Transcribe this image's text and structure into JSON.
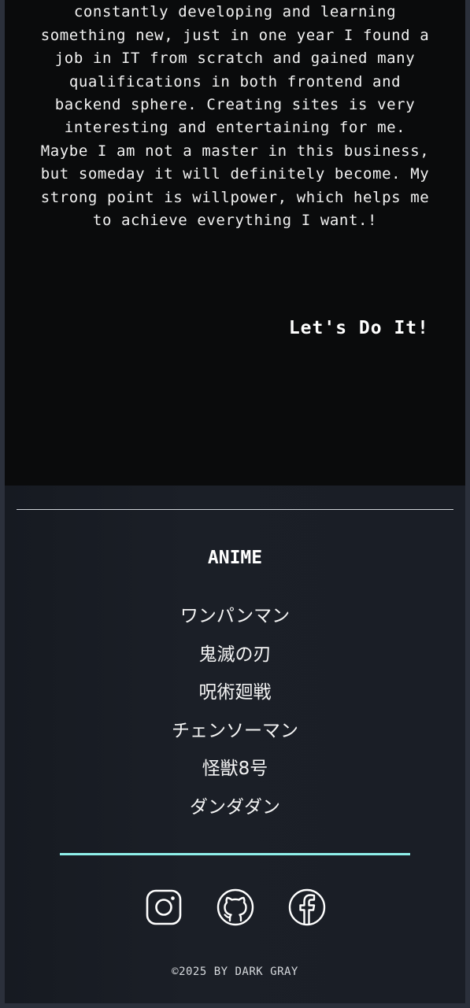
{
  "about": {
    "paragraph": "of the examples of my designer work. I am constantly developing and learning something new, just in one year I found a job in IT from scratch and gained many qualifications in both frontend and backend sphere. Creating sites is very interesting and entertaining for me. Maybe I am not a master in this business, but someday it will definitely become. My strong point is willpower, which helps me to achieve everything I want.!",
    "cta_label": "Let's Do It!"
  },
  "footer": {
    "title": "ANIME",
    "anime": [
      "ワンパンマン",
      "鬼滅の刃",
      "呪術廻戦",
      "チェンソーマン",
      "怪獣8号",
      "ダンダダン"
    ],
    "socials": [
      {
        "name": "instagram-icon"
      },
      {
        "name": "github-icon"
      },
      {
        "name": "facebook-icon"
      }
    ],
    "copyright": "©2025 BY DARK GRAY"
  },
  "colors": {
    "page_bg": "#2b303b",
    "about_bg": "#0a0b0c",
    "footer_bg": "#1a1e26",
    "accent": "#8ff0ea",
    "text": "#ffffff"
  }
}
